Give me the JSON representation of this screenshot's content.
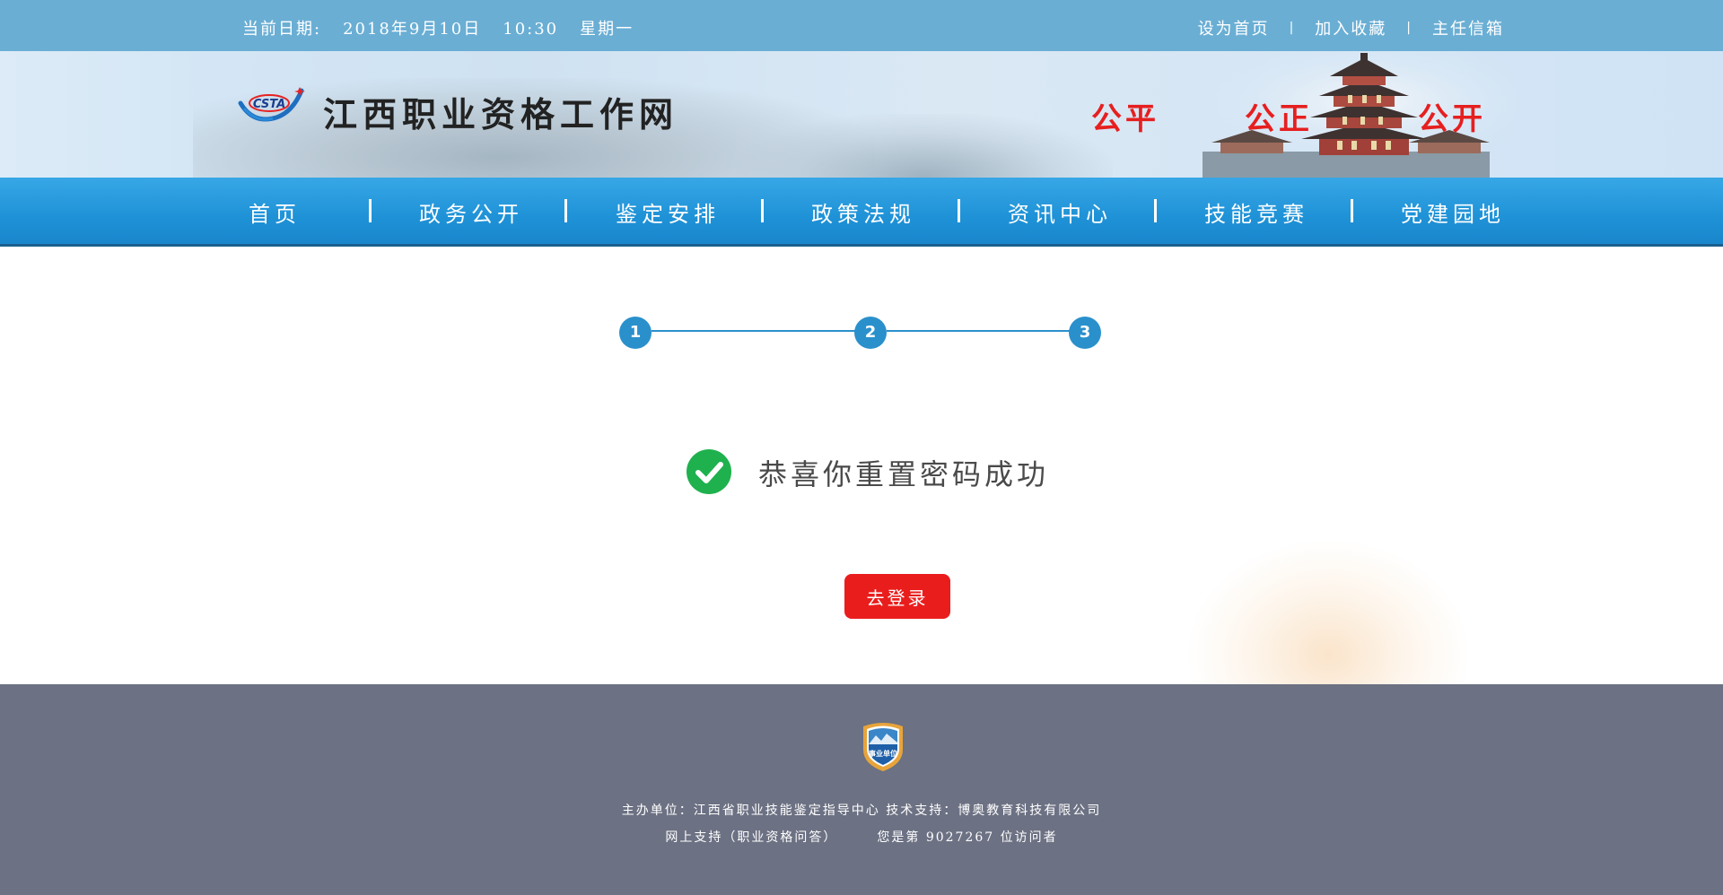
{
  "topbar": {
    "date_label": "当前日期:",
    "date": "2018年9月10日",
    "time": "10:30",
    "weekday": "星期一",
    "links": [
      "设为首页",
      "加入收藏",
      "主任信箱"
    ],
    "separator": "|"
  },
  "header": {
    "logo_text": "CSTA",
    "site_title": "江西职业资格工作网",
    "slogans": [
      "公平",
      "公正",
      "公开"
    ]
  },
  "nav": {
    "items": [
      "首页",
      "政务公开",
      "鉴定安排",
      "政策法规",
      "资讯中心",
      "技能竞赛",
      "党建园地"
    ]
  },
  "steps": [
    "1",
    "2",
    "3"
  ],
  "main": {
    "success_message": "恭喜你重置密码成功",
    "login_button": "去登录"
  },
  "footer": {
    "badge_text": "事业单位",
    "host": "主办单位：江西省职业技能鉴定指导中心",
    "tech": "技术支持：博奥教育科技有限公司",
    "support": "网上支持（职业资格问答）",
    "visitor_prefix": "您是第",
    "visitor_count": "9027267",
    "visitor_suffix": "位访问者"
  },
  "colors": {
    "topbar": "#6aaed4",
    "nav": "#1f92d7",
    "step": "#2a90cc",
    "success": "#1fb14e",
    "button": "#ea1d1d",
    "slogan": "#e61f1f",
    "footer": "#6c7183"
  }
}
